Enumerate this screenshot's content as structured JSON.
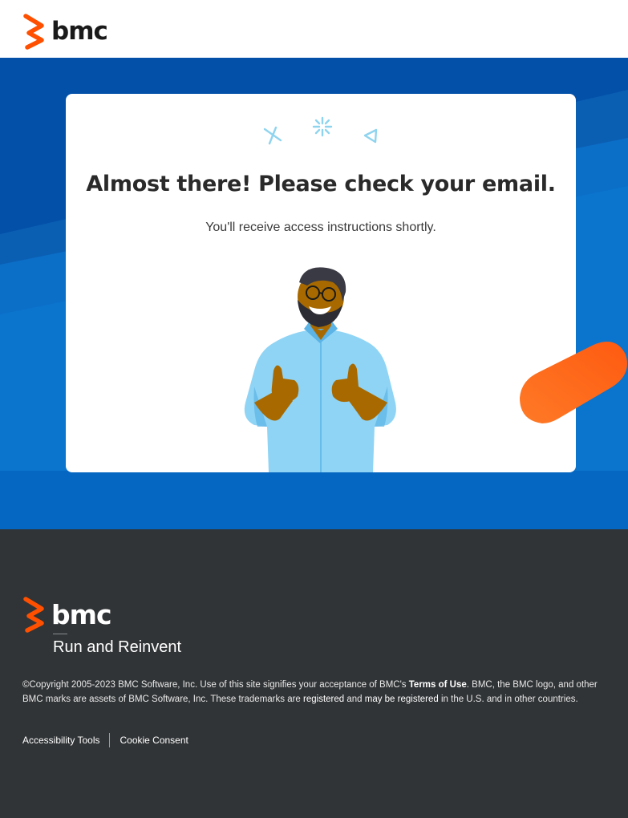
{
  "header": {
    "logo_text": "bmc",
    "logo_icon": "bmc-chevron-logo-icon"
  },
  "hero": {
    "title": "Almost there! Please check your email.",
    "subtitle": "You'll receive access instructions shortly.",
    "illustration": "thumbs-up-person-illustration"
  },
  "footer": {
    "logo_text": "bmc",
    "tagline": "Run and Reinvent",
    "copyright": {
      "part1": "©Copyright 2005-2023 BMC Software, Inc. Use of this site signifies your acceptance of BMC's ",
      "terms_link": "Terms of Use",
      "part2": ". BMC, the BMC logo, and other BMC marks are assets of BMC Software, Inc. These trademarks are ",
      "registered_link": "registered",
      "part3": " and ",
      "may_be_registered_link": "may be registered",
      "part4": " in the U.S. and in other countries."
    },
    "links": {
      "accessibility": "Accessibility Tools",
      "cookie": "Cookie Consent"
    }
  },
  "colors": {
    "brand_orange": "#fe5000",
    "hero_blue": "#0a5fb3",
    "footer_bg": "#313436"
  }
}
